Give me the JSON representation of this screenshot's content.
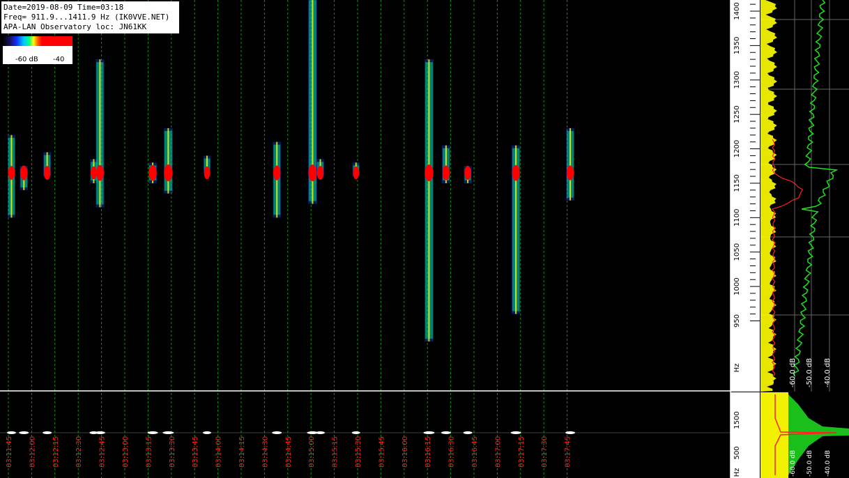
{
  "info": {
    "line1": "Date=2019-08-09 Time=03:18",
    "line2": "Freq= 911.9...1411.9 Hz (IK0VVE.NET)",
    "line3": "APA-LAN Observatory loc: JN61KK"
  },
  "colorbar": {
    "label_left": "-60 dB",
    "label_right": "-40"
  },
  "time_axis": {
    "labels": [
      "03:11:45",
      "03:12:00",
      "03:12:15",
      "03:12:30",
      "03:12:45",
      "03:13:00",
      "03:13:15",
      "03:13:30",
      "03:13:45",
      "03:14:00",
      "03:14:15",
      "03:14:30",
      "03:14:45",
      "03:15:00",
      "03:15:15",
      "03:15:30",
      "03:15:45",
      "03:16:00",
      "03:16:15",
      "03:16:30",
      "03:16:45",
      "03:17:00",
      "03:17:15",
      "03:17:30",
      "03:17:45"
    ]
  },
  "freq_axis": {
    "labels": [
      "1400",
      "1350",
      "1300",
      "1250",
      "1200",
      "1150",
      "1100",
      "1050",
      "1000",
      "950",
      "Hz"
    ]
  },
  "freq_axis_low": {
    "labels": [
      "1500",
      "500",
      "Hz"
    ]
  },
  "spectrum_db_labels": [
    "-60.0 dB",
    "-50.0 dB",
    "-40.0 dB"
  ],
  "spectrum_low_db_labels": [
    "-60.0 dB",
    "-50.0 dB",
    "-40.0 dB"
  ],
  "colors": {
    "grid": "#1f8a1f",
    "timelabel": "#ff2020",
    "signal_core": "#ff0000",
    "spectrum_peak": "#ffff00",
    "spectrum_avg": "#20e020",
    "spectrum_ref": "#ff2020"
  },
  "events": [
    {
      "time": "03:11:47",
      "f_lo": 1100,
      "f_hi": 1220,
      "strength": 0.7
    },
    {
      "time": "03:11:55",
      "f_lo": 1140,
      "f_hi": 1175,
      "strength": 0.8
    },
    {
      "time": "03:12:10",
      "f_lo": 1160,
      "f_hi": 1195,
      "strength": 0.7
    },
    {
      "time": "03:12:40",
      "f_lo": 1150,
      "f_hi": 1185,
      "strength": 0.6
    },
    {
      "time": "03:12:44",
      "f_lo": 1115,
      "f_hi": 1330,
      "strength": 0.9
    },
    {
      "time": "03:13:18",
      "f_lo": 1150,
      "f_hi": 1180,
      "strength": 0.9
    },
    {
      "time": "03:13:28",
      "f_lo": 1135,
      "f_hi": 1230,
      "strength": 1.0
    },
    {
      "time": "03:13:53",
      "f_lo": 1165,
      "f_hi": 1190,
      "strength": 0.6
    },
    {
      "time": "03:14:38",
      "f_lo": 1100,
      "f_hi": 1210,
      "strength": 0.8
    },
    {
      "time": "03:15:01",
      "f_lo": 1120,
      "f_hi": 1420,
      "strength": 1.0
    },
    {
      "time": "03:15:06",
      "f_lo": 1160,
      "f_hi": 1185,
      "strength": 0.7
    },
    {
      "time": "03:15:29",
      "f_lo": 1160,
      "f_hi": 1180,
      "strength": 0.6
    },
    {
      "time": "03:16:16",
      "f_lo": 920,
      "f_hi": 1330,
      "strength": 1.0
    },
    {
      "time": "03:16:27",
      "f_lo": 1150,
      "f_hi": 1205,
      "strength": 0.8
    },
    {
      "time": "03:16:41",
      "f_lo": 1150,
      "f_hi": 1175,
      "strength": 0.7
    },
    {
      "time": "03:17:12",
      "f_lo": 960,
      "f_hi": 1205,
      "strength": 0.9
    },
    {
      "time": "03:17:47",
      "f_lo": 1125,
      "f_hi": 1230,
      "strength": 0.8
    }
  ]
}
